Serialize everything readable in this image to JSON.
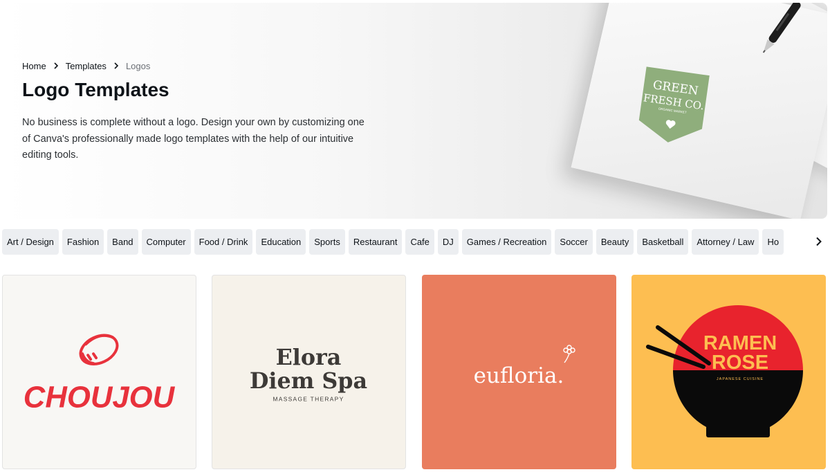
{
  "breadcrumb": {
    "items": [
      "Home",
      "Templates",
      "Logos"
    ]
  },
  "hero": {
    "title": "Logo Templates",
    "description": "No business is complete without a logo. Design your own by customizing one of Canva's professionally made logo templates with the help of our intuitive editing tools."
  },
  "mockup_logo": {
    "line1": "GREEN",
    "line2": "FRESH CO.",
    "tagline": "ORGANIC MARKET",
    "color": "#8fae7c"
  },
  "categories": [
    "Art / Design",
    "Fashion",
    "Band",
    "Computer",
    "Food / Drink",
    "Education",
    "Sports",
    "Restaurant",
    "Cafe",
    "DJ",
    "Games / Recreation",
    "Soccer",
    "Beauty",
    "Basketball",
    "Attorney / Law",
    "Ho"
  ],
  "templates": [
    {
      "name": "CHOUJOU",
      "color": "#e8323c"
    },
    {
      "line1": "Elora",
      "line2": "Diem Spa",
      "subtitle": "MASSAGE THERAPY"
    },
    {
      "name": "eufloria."
    },
    {
      "line1": "RAMEN",
      "line2": "ROSE",
      "subtitle": "JAPANESE CUISINE"
    }
  ],
  "icons": {
    "chevron": "chevron-right-icon",
    "heart": "heart-icon",
    "flower": "flower-icon"
  }
}
